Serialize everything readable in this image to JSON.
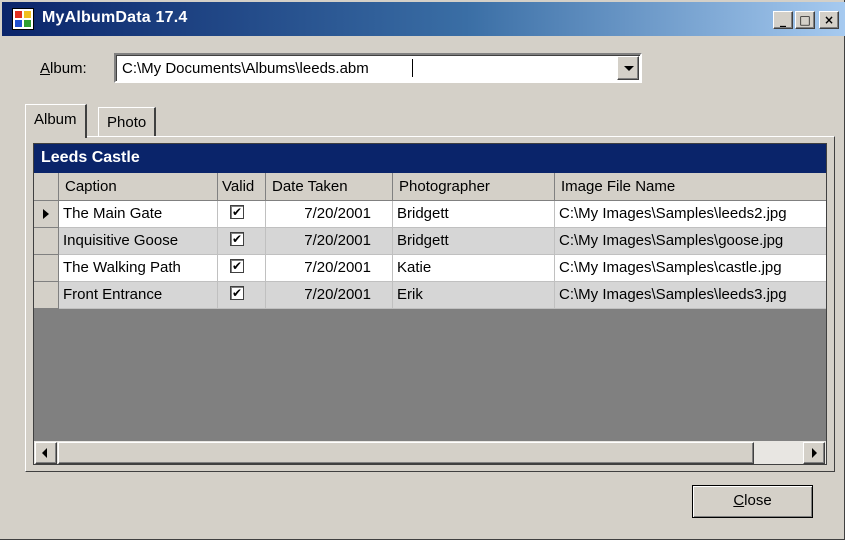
{
  "window": {
    "title": "MyAlbumData 17.4",
    "controls": {
      "minimize": "_",
      "maximize": "□",
      "close": "×"
    }
  },
  "album": {
    "label_prefix": "",
    "label_accel": "A",
    "label_rest": "lbum:",
    "value": "C:\\My Documents\\Albums\\leeds.abm"
  },
  "tabs": [
    {
      "label": "Album",
      "active": true
    },
    {
      "label": "Photo",
      "active": false
    }
  ],
  "grid": {
    "caption": "Leeds Castle",
    "columns": [
      "Caption",
      "Valid",
      "Date Taken",
      "Photographer",
      "Image File Name"
    ],
    "rows": [
      {
        "caption": "The Main Gate",
        "valid": true,
        "date": "7/20/2001",
        "photographer": "Bridgett",
        "file": "C:\\My Images\\Samples\\leeds2.jpg",
        "current": true
      },
      {
        "caption": "Inquisitive Goose",
        "valid": true,
        "date": "7/20/2001",
        "photographer": "Bridgett",
        "file": "C:\\My Images\\Samples\\goose.jpg",
        "current": false
      },
      {
        "caption": "The Walking Path",
        "valid": true,
        "date": "7/20/2001",
        "photographer": "Katie",
        "file": "C:\\My Images\\Samples\\castle.jpg",
        "current": false
      },
      {
        "caption": "Front Entrance",
        "valid": true,
        "date": "7/20/2001",
        "photographer": "Erik",
        "file": "C:\\My Images\\Samples\\leeds3.jpg",
        "current": false
      }
    ],
    "checkmark": "✔"
  },
  "buttons": {
    "close_accel": "C",
    "close_rest": "lose"
  },
  "colors": {
    "title_bar": "#0a246a",
    "grid_caption": "#0a246a",
    "window_face": "#d4d0c8",
    "grid_background": "#808080"
  }
}
